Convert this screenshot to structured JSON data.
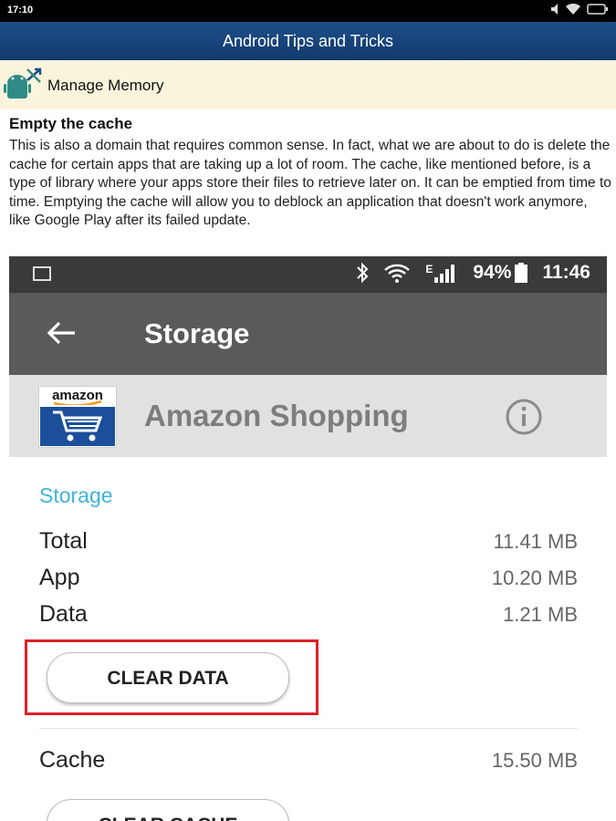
{
  "device": {
    "time": "17:10"
  },
  "app": {
    "title": "Android Tips and Tricks"
  },
  "section": {
    "label": "Manage Memory",
    "icon": "android-tools-icon"
  },
  "article": {
    "heading": "Empty the cache",
    "body": "This is also a domain that requires common sense. In fact, what we are about to do is delete the cache for certain apps that are taking up a lot of room. The cache, like mentioned before, is a type of library where your apps store their files to retrieve later on. It can be emptied from time to time. Emptying the cache will allow you to deblock an application that doesn't work anymore, like Google Play after its failed update."
  },
  "screenshot": {
    "status": {
      "network": "E",
      "battery": "94%",
      "time": "11:46"
    },
    "toolbar_title": "Storage",
    "app_logo_text": "amazon",
    "app_name": "Amazon Shopping",
    "storage_header": "Storage",
    "rows": [
      {
        "label": "Total",
        "value": "11.41 MB"
      },
      {
        "label": "App",
        "value": "10.20 MB"
      },
      {
        "label": "Data",
        "value": "1.21 MB"
      }
    ],
    "clear_data_label": "CLEAR DATA",
    "cache": {
      "label": "Cache",
      "value": "15.50 MB"
    },
    "clear_cache_label": "CLEAR CACHE",
    "highlight_color": "#e01f26",
    "accent_color": "#3fb3d9"
  }
}
